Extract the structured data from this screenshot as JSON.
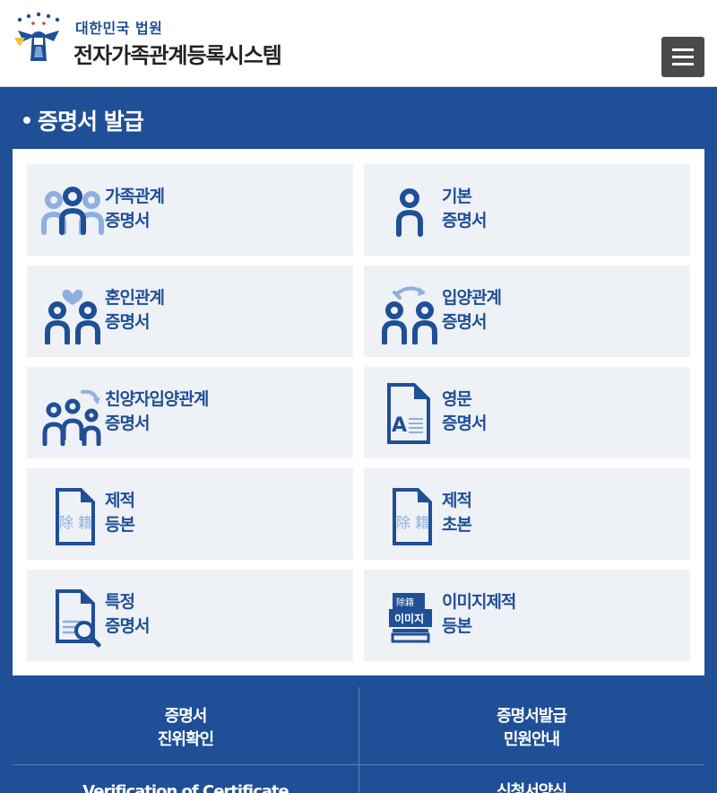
{
  "header": {
    "org": "대한민국 법원",
    "title": "전자가족관계등록시스템",
    "menu_icon": "hamburger-menu-icon"
  },
  "section": {
    "title": "증명서 발급"
  },
  "colors": {
    "brand": "#1f4f96",
    "card_bg": "#eef1f6",
    "icon_light": "#8eb0dc"
  },
  "cards": [
    {
      "line1": "가족관계",
      "line2": "증명서",
      "icon": "family-group-icon"
    },
    {
      "line1": "기본",
      "line2": "증명서",
      "icon": "single-person-icon"
    },
    {
      "line1": "혼인관계",
      "line2": "증명서",
      "icon": "marriage-heart-icon"
    },
    {
      "line1": "입양관계",
      "line2": "증명서",
      "icon": "adoption-arrow-icon"
    },
    {
      "line1": "친양자입양관계",
      "line2": "증명서",
      "icon": "full-adoption-family-icon"
    },
    {
      "line1": "영문",
      "line2": "증명서",
      "icon": "english-document-icon"
    },
    {
      "line1": "제적",
      "line2": "등본",
      "icon": "removed-register-document-icon",
      "stamp": "除 籍"
    },
    {
      "line1": "제적",
      "line2": "초본",
      "icon": "removed-register-document-icon",
      "stamp": "除 籍"
    },
    {
      "line1": "특정",
      "line2": "증명서",
      "icon": "document-magnifier-icon"
    },
    {
      "line1": "이미지제적",
      "line2": "등본",
      "icon": "image-register-icon",
      "stamp": "이미지",
      "stamp_small": "除籍"
    }
  ],
  "bottom": {
    "verify_line1": "증명서",
    "verify_line2": "진위확인",
    "guide_line1": "증명서발급",
    "guide_line2": "민원안내",
    "verify_en": "Verification of Certificate",
    "form": "신청서양식"
  }
}
